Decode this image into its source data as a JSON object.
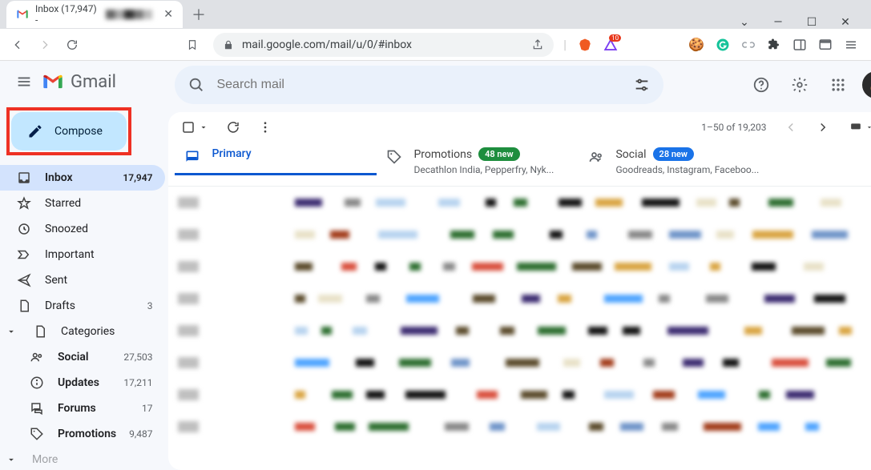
{
  "browser": {
    "tab_title": "Inbox (17,947) - ",
    "url": "mail.google.com/mail/u/0/#inbox"
  },
  "gmail": {
    "app_name": "Gmail",
    "compose_label": "Compose",
    "search_placeholder": "Search mail",
    "nav": [
      {
        "id": "inbox",
        "label": "Inbox",
        "count": "17,947",
        "active": true,
        "icon": "inbox"
      },
      {
        "id": "starred",
        "label": "Starred",
        "icon": "star"
      },
      {
        "id": "snoozed",
        "label": "Snoozed",
        "icon": "clock"
      },
      {
        "id": "important",
        "label": "Important",
        "icon": "important"
      },
      {
        "id": "sent",
        "label": "Sent",
        "icon": "send"
      },
      {
        "id": "drafts",
        "label": "Drafts",
        "count": "3",
        "icon": "file"
      },
      {
        "id": "categories",
        "label": "Categories",
        "icon": "file",
        "expand": true
      }
    ],
    "subnav": [
      {
        "id": "social",
        "label": "Social",
        "count": "27,503",
        "icon": "people"
      },
      {
        "id": "updates",
        "label": "Updates",
        "count": "17,211",
        "icon": "info"
      },
      {
        "id": "forums",
        "label": "Forums",
        "count": "17",
        "icon": "forum"
      },
      {
        "id": "promotions",
        "label": "Promotions",
        "count": "9,487",
        "icon": "tag"
      }
    ],
    "more_label": "More",
    "pagination": "1–50 of 19,203",
    "tabs": {
      "primary": {
        "title": "Primary"
      },
      "promotions": {
        "title": "Promotions",
        "badge": "48 new",
        "sub": "Decathlon India, Pepperfry, Nyk..."
      },
      "social": {
        "title": "Social",
        "badge": "28 new",
        "sub": "Goodreads, Instagram, Faceboo..."
      }
    }
  }
}
